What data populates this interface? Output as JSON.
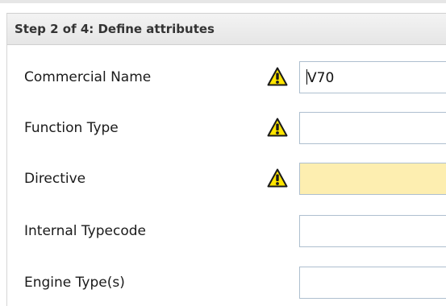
{
  "step_header": {
    "title": "Step 2 of 4: Define attributes"
  },
  "colors": {
    "header_bg": "#e6e6e6",
    "field_border": "#aebfcf",
    "highlight_field_bg": "#fdeeb0",
    "warning_icon": "#ffe500"
  },
  "fields": [
    {
      "label": "Commercial Name",
      "value": "V70",
      "warning": true,
      "highlight": false,
      "icon": "warning-icon"
    },
    {
      "label": "Function Type",
      "value": "",
      "warning": true,
      "highlight": false,
      "icon": "warning-icon"
    },
    {
      "label": "Directive",
      "value": "",
      "warning": true,
      "highlight": true,
      "icon": "warning-icon"
    },
    {
      "label": "Internal Typecode",
      "value": "",
      "warning": false,
      "highlight": false
    },
    {
      "label": "Engine Type(s)",
      "value": "",
      "warning": false,
      "highlight": false
    }
  ]
}
